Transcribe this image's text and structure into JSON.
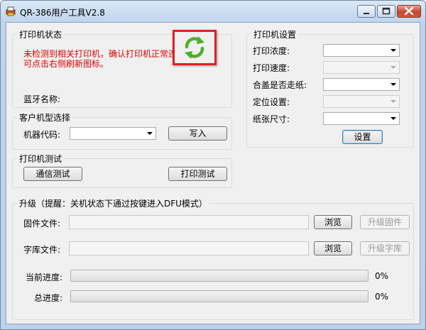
{
  "window": {
    "title": "QR-386用户工具V2.8"
  },
  "status": {
    "group_title": "打印机状态",
    "message": "未检测到相关打印机，确认打印机正常连接后可点击右侧刷新图标。",
    "bluetooth_label": "蓝牙名称:"
  },
  "model": {
    "group_title": "客户机型选择",
    "code_label": "机器代码:",
    "code_value": "",
    "write_button": "写入"
  },
  "test": {
    "group_title": "打印机测试",
    "comm_button": "通信测试",
    "print_button": "打印测试"
  },
  "settings": {
    "group_title": "打印机设置",
    "fields": [
      {
        "label": "打印浓度:",
        "value": "",
        "enabled": true
      },
      {
        "label": "打印速度:",
        "value": "",
        "enabled": false
      },
      {
        "label": "合盖是否走纸:",
        "value": "",
        "enabled": true
      },
      {
        "label": "定位设置:",
        "value": "",
        "enabled": false
      },
      {
        "label": "纸张尺寸:",
        "value": "",
        "enabled": true
      }
    ],
    "apply_button": "设置"
  },
  "upgrade": {
    "group_title": "升级（提醒：关机状态下通过按键进入DFU模式）",
    "firmware_label": "固件文件:",
    "firmware_path": "",
    "font_label": "字库文件:",
    "font_path": "",
    "browse_label": "浏览",
    "upgrade_firmware_button": "升级固件",
    "upgrade_font_button": "升级字库",
    "current_progress_label": "当前进度:",
    "current_progress_value": 0,
    "current_progress_text": "0%",
    "total_progress_label": "总进度:",
    "total_progress_value": 0,
    "total_progress_text": "0%"
  },
  "colors": {
    "error_text": "#e00000",
    "highlight_border": "#e02020",
    "refresh_icon": "#4caf2a"
  },
  "icons": {
    "app": "printer-app-icon",
    "refresh": "refresh-icon"
  }
}
